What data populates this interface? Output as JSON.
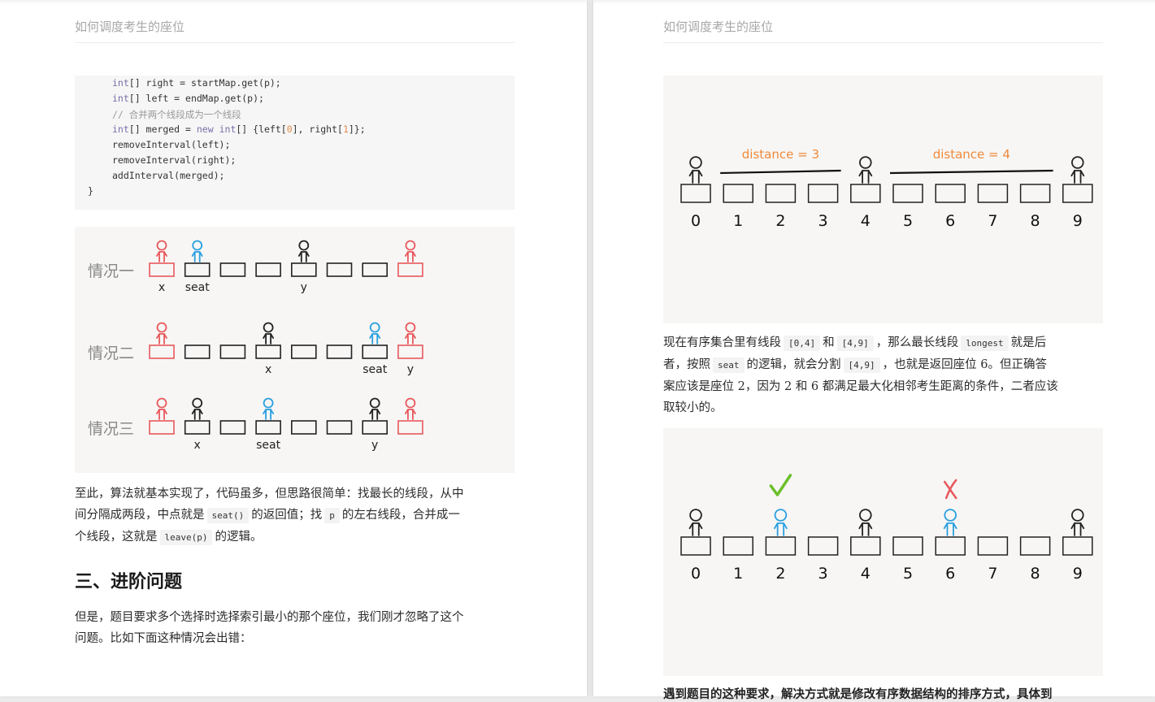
{
  "document": {
    "running_title": "如何调度考生的座位"
  },
  "left_page": {
    "code": {
      "lines": [
        {
          "parts": [
            {
              "t": "int",
              "c": "kw"
            },
            {
              "t": "[] right = startMap.get(p);"
            }
          ]
        },
        {
          "parts": [
            {
              "t": "int",
              "c": "kw"
            },
            {
              "t": "[] left = endMap.get(p);"
            }
          ]
        },
        {
          "parts": [
            {
              "t": "// 合并两个线段成为一个线段",
              "c": "cm"
            }
          ]
        },
        {
          "parts": [
            {
              "t": "int",
              "c": "kw"
            },
            {
              "t": "[] merged = "
            },
            {
              "t": "new",
              "c": "kw"
            },
            {
              "t": " "
            },
            {
              "t": "int",
              "c": "kw"
            },
            {
              "t": "[] {left["
            },
            {
              "t": "0",
              "c": "num"
            },
            {
              "t": "], right["
            },
            {
              "t": "1",
              "c": "num"
            },
            {
              "t": "]};"
            }
          ]
        },
        {
          "parts": [
            {
              "t": "removeInterval(left);"
            }
          ]
        },
        {
          "parts": [
            {
              "t": "removeInterval(right);"
            }
          ]
        },
        {
          "parts": [
            {
              "t": "addInterval(merged);"
            }
          ]
        },
        {
          "parts": [
            {
              "t": "}"
            }
          ]
        }
      ]
    },
    "cases_figure": {
      "rows": [
        {
          "label": "情况一",
          "red_seats": [
            0,
            7
          ],
          "people": [
            {
              "seat": 0,
              "color": "red"
            },
            {
              "seat": 1,
              "color": "blue"
            },
            {
              "seat": 4,
              "color": "black"
            },
            {
              "seat": 7,
              "color": "red"
            }
          ],
          "marks": [
            {
              "seat": 0,
              "text": "x"
            },
            {
              "seat": 1,
              "text": "seat"
            },
            {
              "seat": 4,
              "text": "y"
            }
          ]
        },
        {
          "label": "情况二",
          "red_seats": [
            0,
            7
          ],
          "people": [
            {
              "seat": 0,
              "color": "red"
            },
            {
              "seat": 3,
              "color": "black"
            },
            {
              "seat": 6,
              "color": "blue"
            },
            {
              "seat": 7,
              "color": "red"
            }
          ],
          "marks": [
            {
              "seat": 3,
              "text": "x"
            },
            {
              "seat": 6,
              "text": "seat"
            },
            {
              "seat": 7,
              "text": "y"
            }
          ]
        },
        {
          "label": "情况三",
          "red_seats": [
            0,
            7
          ],
          "people": [
            {
              "seat": 0,
              "color": "red"
            },
            {
              "seat": 1,
              "color": "black"
            },
            {
              "seat": 3,
              "color": "blue"
            },
            {
              "seat": 6,
              "color": "black"
            },
            {
              "seat": 7,
              "color": "red"
            }
          ],
          "marks": [
            {
              "seat": 1,
              "text": "x"
            },
            {
              "seat": 3,
              "text": "seat"
            },
            {
              "seat": 6,
              "text": "y"
            }
          ]
        }
      ],
      "seat_count": 8
    },
    "para1": {
      "line1": "至此，算法就基本实现了，代码虽多，但思路很简单：找最长的线段，从中",
      "line2_a": "间分隔成两段，中点就是",
      "line2_code1": "seat()",
      "line2_b": "的返回值；找",
      "line2_code2": "p",
      "line2_c": "的左右线段，合并成一",
      "line3_a": "个线段，这就是",
      "line3_code": "leave(p)",
      "line3_b": "的逻辑。"
    },
    "heading": "三、进阶问题",
    "para2": {
      "line1": "但是，题目要求多个选择时选择索引最小的那个座位，我们刚才忽略了这个",
      "line2": "问题。比如下面这种情况会出错："
    }
  },
  "right_page": {
    "figure1": {
      "seat_labels": [
        "0",
        "1",
        "2",
        "3",
        "4",
        "5",
        "6",
        "7",
        "8",
        "9"
      ],
      "occupied": [
        0,
        4,
        9
      ],
      "distance_labels": [
        {
          "text": "distance = 3",
          "from": 1,
          "to": 3
        },
        {
          "text": "distance = 4",
          "from": 5,
          "to": 8
        }
      ]
    },
    "para1": {
      "l1_a": "现在有序集合里有线段",
      "l1_code1": "[0,4]",
      "l1_b": "和",
      "l1_code2": "[4,9]",
      "l1_c": "，那么最长线段",
      "l1_code3": "longest",
      "l1_d": "就是后",
      "l2_a": "者，按照",
      "l2_code1": "seat",
      "l2_b": "的逻辑，就会分割",
      "l2_code2": "[4,9]",
      "l2_c": "，也就是返回座位 6。但正确答",
      "l3": "案应该是座位 2，因为 2 和 6 都满足最大化相邻考生距离的条件，二者应该",
      "l4": "取较小的。"
    },
    "figure2": {
      "seat_labels": [
        "0",
        "1",
        "2",
        "3",
        "4",
        "5",
        "6",
        "7",
        "8",
        "9"
      ],
      "occupied_black": [
        0,
        4,
        9
      ],
      "candidates": [
        {
          "seat": 2,
          "mark": "check"
        },
        {
          "seat": 6,
          "mark": "cross"
        }
      ]
    },
    "cut_text": "遇到题目的这种要求，解决方式就是修改有序数据结构的排序方式，具体到"
  },
  "colors": {
    "red": "#e8585c",
    "blue": "#2a9fe0",
    "black": "#222222",
    "orange": "#ef8a3c",
    "green": "#6cbf2a"
  }
}
